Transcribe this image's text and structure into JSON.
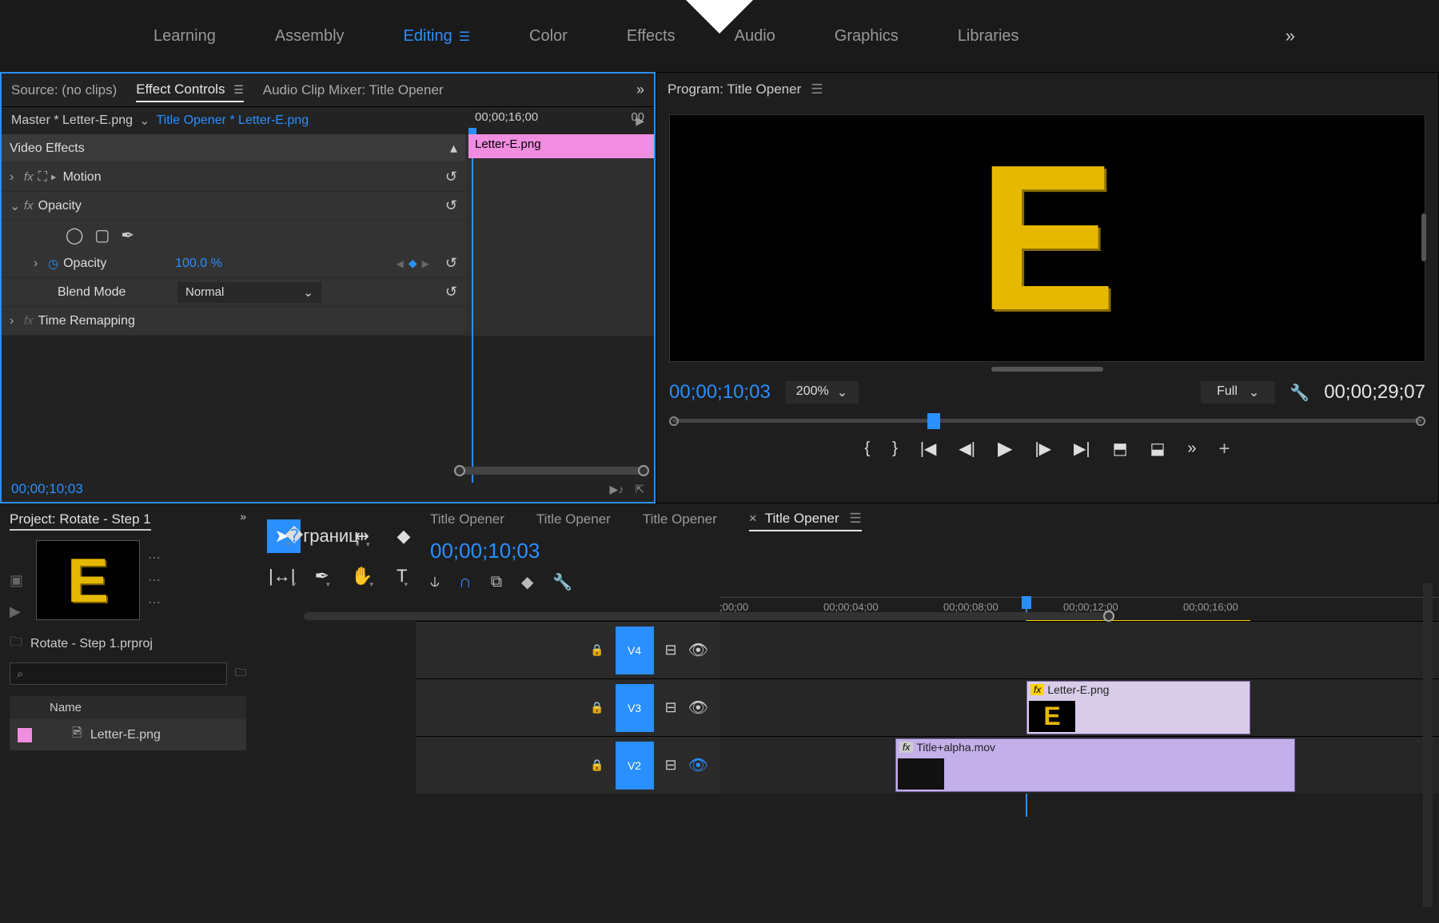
{
  "workspaces": {
    "items": [
      "Learning",
      "Assembly",
      "Editing",
      "Color",
      "Effects",
      "Audio",
      "Graphics",
      "Libraries"
    ],
    "active": "Editing"
  },
  "source_panel": {
    "tabs": {
      "source": "Source: (no clips)",
      "effect_controls": "Effect Controls",
      "audio_mixer": "Audio Clip Mixer: Title Opener"
    },
    "master": "Master * Letter-E.png",
    "sequence": "Title Opener * Letter-E.png",
    "timeruler": {
      "t1": "00;00;16;00",
      "t2": "00"
    },
    "clip_label": "Letter-E.png",
    "video_effects": "Video Effects",
    "motion": "Motion",
    "opacity_label": "Opacity",
    "opacity_prop": "Opacity",
    "opacity_value": "100.0 %",
    "blend_mode_label": "Blend Mode",
    "blend_mode_value": "Normal",
    "time_remapping": "Time Remapping",
    "current_tc": "00;00;10;03"
  },
  "program": {
    "title": "Program: Title Opener",
    "letter": "E",
    "current_tc": "00;00;10;03",
    "zoom": "200%",
    "resolution": "Full",
    "duration": "00;00;29;07"
  },
  "project": {
    "tab": "Project: Rotate - Step 1",
    "filename": "Rotate - Step 1.prproj",
    "name_header": "Name",
    "item": "Letter-E.png",
    "thumb_letter": "E"
  },
  "timeline": {
    "tabs": [
      "Title Opener",
      "Title Opener",
      "Title Opener",
      "Title Opener"
    ],
    "current_tc": "00;00;10;03",
    "ruler": [
      ";00;00",
      "00;00;04;00",
      "00;00;08;00",
      "00;00;12;00",
      "00;00;16;00"
    ],
    "tracks": {
      "v4": "V4",
      "v3": "V3",
      "v2": "V2"
    },
    "clips": {
      "letter": "Letter-E.png",
      "title_alpha": "Title+alpha.mov"
    }
  }
}
